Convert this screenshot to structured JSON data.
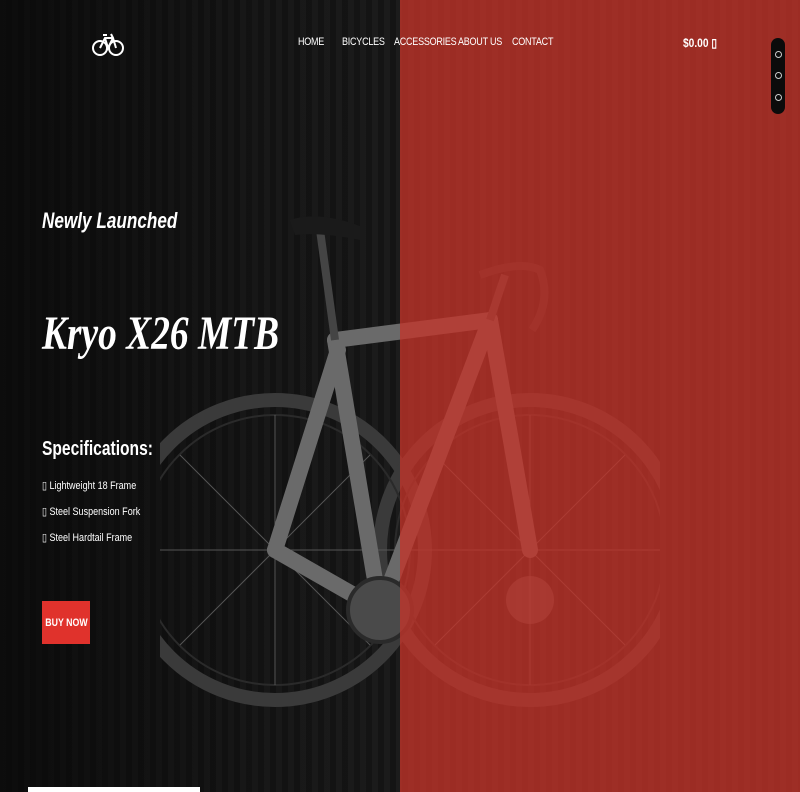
{
  "brand": {
    "logo_icon": "bicycle-logo-icon"
  },
  "nav": {
    "items": [
      {
        "label": "HOME"
      },
      {
        "label": "BICYCLES"
      },
      {
        "label": "ACCESSORIES"
      },
      {
        "label": "ABOUT US"
      },
      {
        "label": "CONTACT"
      }
    ]
  },
  "cart": {
    "label": "$0.00 ▯",
    "icon": "cart-icon"
  },
  "hero": {
    "eyebrow": "Newly Launched",
    "title": "Kryo X26 MTB",
    "specs_heading": "Specifications:",
    "specs": [
      "▯ Lightweight 18 Frame",
      "▯ Steel Suspension Fork",
      "▯ Steel Hardtail Frame"
    ],
    "cta_label": "BUY NOW"
  },
  "side_toolbar": {
    "icons": [
      "chat-icon",
      "help-icon",
      "share-icon"
    ]
  },
  "colors": {
    "accent": "#e0322c",
    "overlay": "#c4342a",
    "background": "#111111"
  }
}
